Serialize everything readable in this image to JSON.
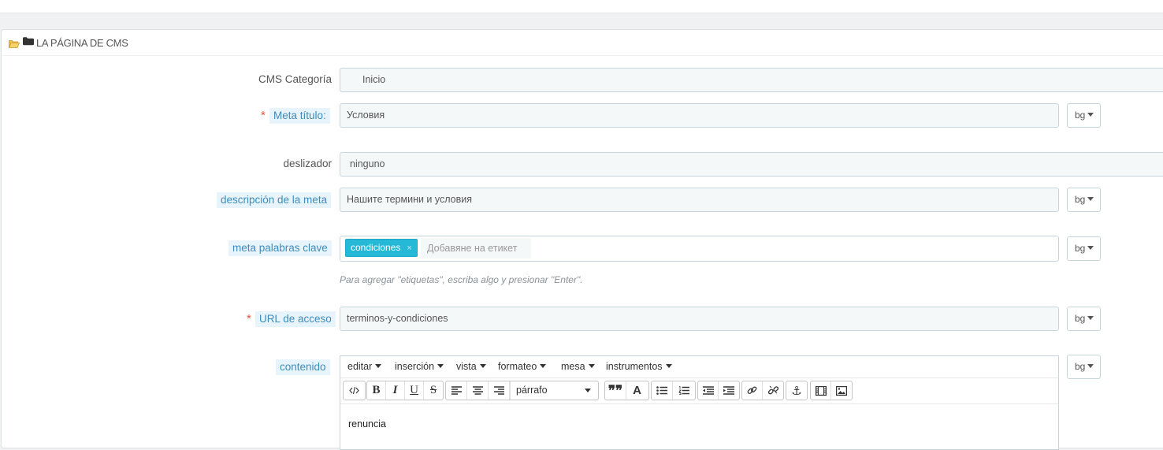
{
  "panel": {
    "title": "LA PÁGINA DE CMS",
    "icons": [
      "folder-open-icon",
      "folder-icon"
    ]
  },
  "fields": {
    "cms_category": {
      "label": "CMS Categoría",
      "value": "Inicio"
    },
    "meta_title": {
      "required": "*",
      "label": "Meta título:",
      "value": "Условия",
      "lang": "bg"
    },
    "slider": {
      "label": "deslizador",
      "value": "ninguno"
    },
    "meta_description": {
      "label": "descripción de la meta",
      "value": "Нашите термини и условия",
      "lang": "bg"
    },
    "meta_keywords": {
      "label": "meta palabras clave",
      "tags": [
        {
          "text": "condiciones",
          "remove": "×"
        }
      ],
      "placeholder": "Добавяне на етикет",
      "help": "Para agregar \"etiquetas\", escriba algo y presionar \"Enter\".",
      "lang": "bg"
    },
    "url": {
      "required": "*",
      "label": "URL de acceso",
      "value": "terminos-y-condiciones",
      "lang": "bg"
    },
    "content": {
      "label": "contenido",
      "lang": "bg",
      "menus": [
        "editar",
        "inserción",
        "vista",
        "formateo",
        "mesa",
        "instrumentos"
      ],
      "format_select": "párrafo",
      "toolbar_icons": [
        "code-icon",
        "bold-icon",
        "italic-icon",
        "underline-icon",
        "strikethrough-icon",
        "align-left-icon",
        "align-center-icon",
        "align-right-icon",
        "blockquote-icon",
        "text-color-icon",
        "bullet-list-icon",
        "numbered-list-icon",
        "outdent-icon",
        "indent-icon",
        "link-icon",
        "unlink-icon",
        "anchor-icon",
        "media-icon",
        "image-icon"
      ],
      "body_text": "renuncia"
    }
  }
}
